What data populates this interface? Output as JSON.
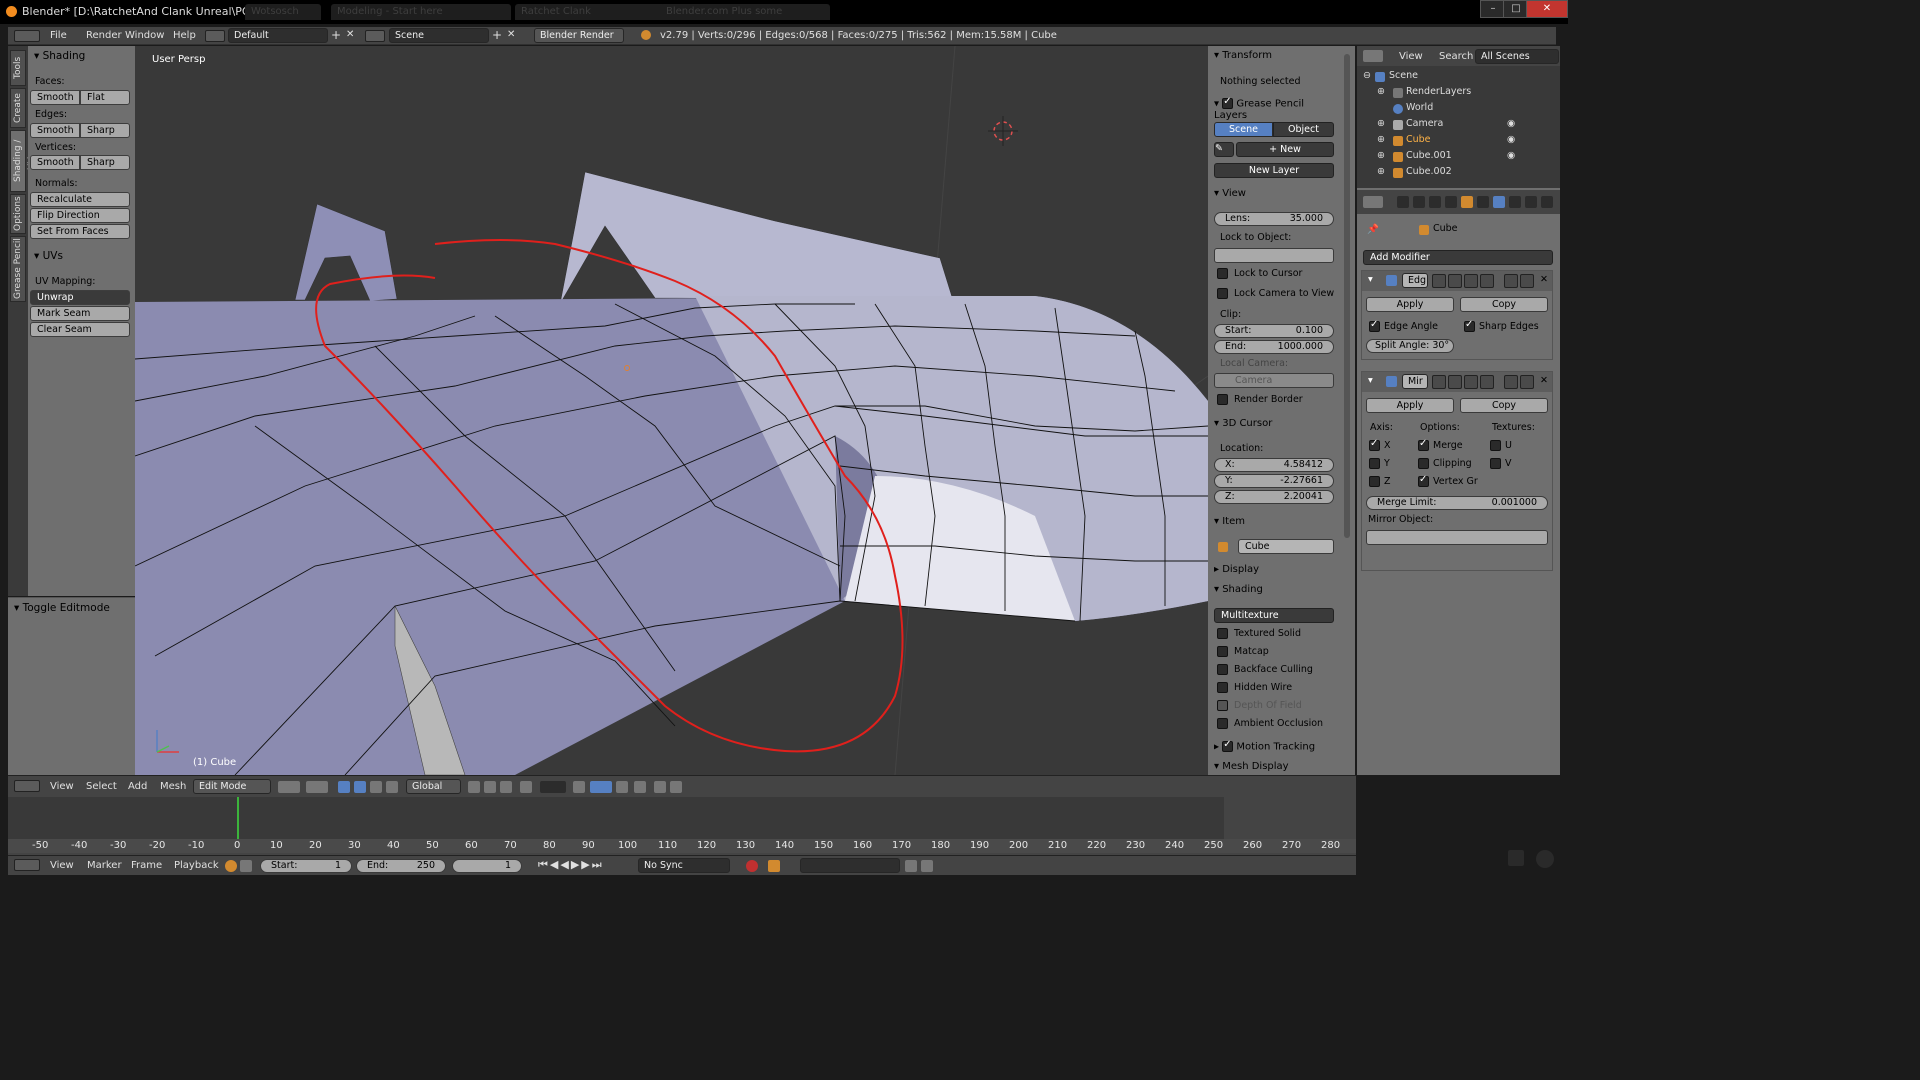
{
  "window": {
    "title": "Blender* [D:\\RatchetAnd Clank Unreal\\POC.blend]",
    "ghost_tabs": [
      "Wotsosch",
      "Modeling - Start here",
      "Ratchet Clank",
      "Blender.com Plus some"
    ]
  },
  "info_header": {
    "menus": [
      "File",
      "Render",
      "Window",
      "Help"
    ],
    "layout": "Default",
    "scene": "Scene",
    "engine": "Blender Render",
    "stats": "v2.79 | Verts:0/296 | Edges:0/568 | Faces:0/275 | Tris:562 | Mem:15.58M | Cube"
  },
  "side_tabs": [
    "Tools",
    "Create",
    "Shading / UVs",
    "Options",
    "Grease Pencil"
  ],
  "tool_shelf": {
    "shading_header": "Shading",
    "faces_label": "Faces:",
    "faces_buttons": [
      "Smooth",
      "Flat"
    ],
    "edges_label": "Edges:",
    "edges_buttons": [
      "Smooth",
      "Sharp"
    ],
    "vertices_label": "Vertices:",
    "vertices_buttons": [
      "Smooth",
      "Sharp"
    ],
    "normals_label": "Normals:",
    "recalculate": "Recalculate",
    "flip_direction": "Flip Direction",
    "set_from_faces": "Set From Faces",
    "uvs_header": "UVs",
    "uv_mapping_label": "UV Mapping:",
    "unwrap": "Unwrap",
    "mark_seam": "Mark Seam",
    "clear_seam": "Clear Seam",
    "toggle_editmode": "Toggle Editmode"
  },
  "viewport": {
    "view_label": "User Persp",
    "object_label": "(1) Cube"
  },
  "properties_panel": {
    "transform_header": "Transform",
    "nothing_selected": "Nothing selected",
    "grease_pencil_header": "Grease Pencil Layers",
    "scene_btn": "Scene",
    "object_btn": "Object",
    "new_btn": "New",
    "new_layer_btn": "New Layer",
    "view_header": "View",
    "lens_label": "Lens:",
    "lens_value": "35.000",
    "lock_to_object": "Lock to Object:",
    "lock_to_cursor": "Lock to Cursor",
    "lock_camera_to_view": "Lock Camera to View",
    "clip_label": "Clip:",
    "clip_start_label": "Start:",
    "clip_start": "0.100",
    "clip_end_label": "End:",
    "clip_end": "1000.000",
    "local_camera": "Local Camera:",
    "camera_field": "Camera",
    "render_border": "Render Border",
    "cursor_header": "3D Cursor",
    "location_label": "Location:",
    "x_label": "X:",
    "x_value": "4.58412",
    "y_label": "Y:",
    "y_value": "-2.27661",
    "z_label": "Z:",
    "z_value": "2.20041",
    "item_header": "Item",
    "item_name": "Cube",
    "display_header": "Display",
    "shading_header": "Shading",
    "shading_mode": "Multitexture",
    "textured_solid": "Textured Solid",
    "matcap": "Matcap",
    "backface_culling": "Backface Culling",
    "hidden_wire": "Hidden Wire",
    "depth_of_field": "Depth Of Field",
    "ambient_occlusion": "Ambient Occlusion",
    "motion_tracking": "Motion Tracking",
    "mesh_display": "Mesh Display"
  },
  "outliner": {
    "view": "View",
    "search": "Search",
    "filter": "All Scenes",
    "rows": [
      "Scene",
      "RenderLayers",
      "World",
      "Camera",
      "Cube",
      "Cube.001",
      "Cube.002"
    ]
  },
  "modifiers": {
    "object_name": "Cube",
    "add_modifier": "Add Modifier",
    "edge_split": {
      "name": "Edg",
      "apply": "Apply",
      "copy": "Copy",
      "edge_angle": "Edge Angle",
      "sharp_edges": "Sharp Edges",
      "split_angle": "Split Angle: 30°"
    },
    "mirror": {
      "name": "Mir",
      "apply": "Apply",
      "copy": "Copy",
      "axis_label": "Axis:",
      "options_label": "Options:",
      "textures_label": "Textures:",
      "x": "X",
      "y": "Y",
      "z": "Z",
      "merge": "Merge",
      "clipping": "Clipping",
      "vertex_groups": "Vertex Gr",
      "u": "U",
      "v": "V",
      "merge_limit_label": "Merge Limit:",
      "merge_limit": "0.001000",
      "mirror_object": "Mirror Object:"
    }
  },
  "view3d_header": {
    "menus": [
      "View",
      "Select",
      "Add",
      "Mesh"
    ],
    "mode": "Edit Mode",
    "orientation": "Global"
  },
  "timeline": {
    "ticks": [
      "-50",
      "-40",
      "-30",
      "-20",
      "-10",
      "0",
      "10",
      "20",
      "30",
      "40",
      "50",
      "60",
      "70",
      "80",
      "90",
      "100",
      "110",
      "120",
      "130",
      "140",
      "150",
      "160",
      "170",
      "180",
      "190",
      "200",
      "210",
      "220",
      "230",
      "240",
      "250",
      "260",
      "270",
      "280"
    ],
    "current_frame": 1,
    "menus": [
      "View",
      "Marker",
      "Frame",
      "Playback"
    ],
    "start_label": "Start:",
    "start": "1",
    "end_label": "End:",
    "end": "250",
    "frame": "1",
    "sync": "No Sync"
  },
  "colors": {
    "accent_blue": "#5680c2",
    "panel_grey": "#6f6f6f",
    "viewport_bg": "#393939",
    "annotation_red": "#e0201c"
  }
}
